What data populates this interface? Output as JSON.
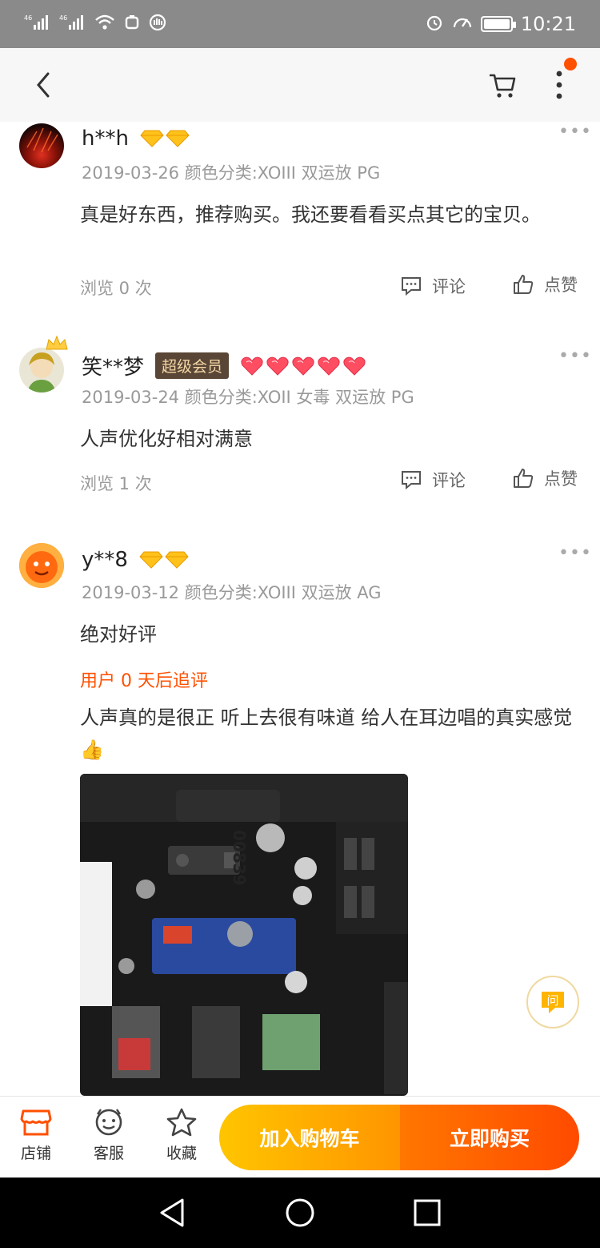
{
  "status_bar": {
    "signal1": "⁴⁶",
    "signal2": "⁴⁶",
    "time": "10:21",
    "battery_level": 0.9
  },
  "nav": {
    "back": "back-icon",
    "cart": "cart-icon",
    "more": "more-icon",
    "has_notification": true
  },
  "reviews": [
    {
      "user": "h**h",
      "diamonds": 2,
      "meta": "2019-03-26 颜色分类:XOIII 双运放 PG",
      "text": "真是好东西，推荐购买。我还要看看买点其它的宝贝。",
      "views": "浏览 0 次",
      "comment": "评论",
      "like": "点赞"
    },
    {
      "user": "笑**梦",
      "level": "超级会员",
      "hearts": 5,
      "meta": "2019-03-24 颜色分类:XOII 女毒 双运放 PG",
      "text": "人声优化好相对满意",
      "views": "浏览 1 次",
      "comment": "评论",
      "like": "点赞"
    },
    {
      "user": "y**8",
      "diamonds": 2,
      "meta": "2019-03-12 颜色分类:XOIII 双运放 AG",
      "text": "绝对好评",
      "append_label": "用户 0 天后追评",
      "append_text": "人声真的是很正 听上去很有味道 给人在耳边唱的真实感觉👍",
      "photo_label": "00839"
    }
  ],
  "ask_button": "问",
  "bottom_bar": {
    "tabs": [
      {
        "label": "店铺",
        "icon": "store-icon"
      },
      {
        "label": "客服",
        "icon": "service-icon"
      },
      {
        "label": "收藏",
        "icon": "star-icon"
      }
    ],
    "add_to_cart": "加入购物车",
    "buy_now": "立即购买"
  },
  "colors": {
    "accent": "#ff5000",
    "cart_button": "#ffa800",
    "buy_button": "#ff5a00",
    "meta": "#999999"
  }
}
